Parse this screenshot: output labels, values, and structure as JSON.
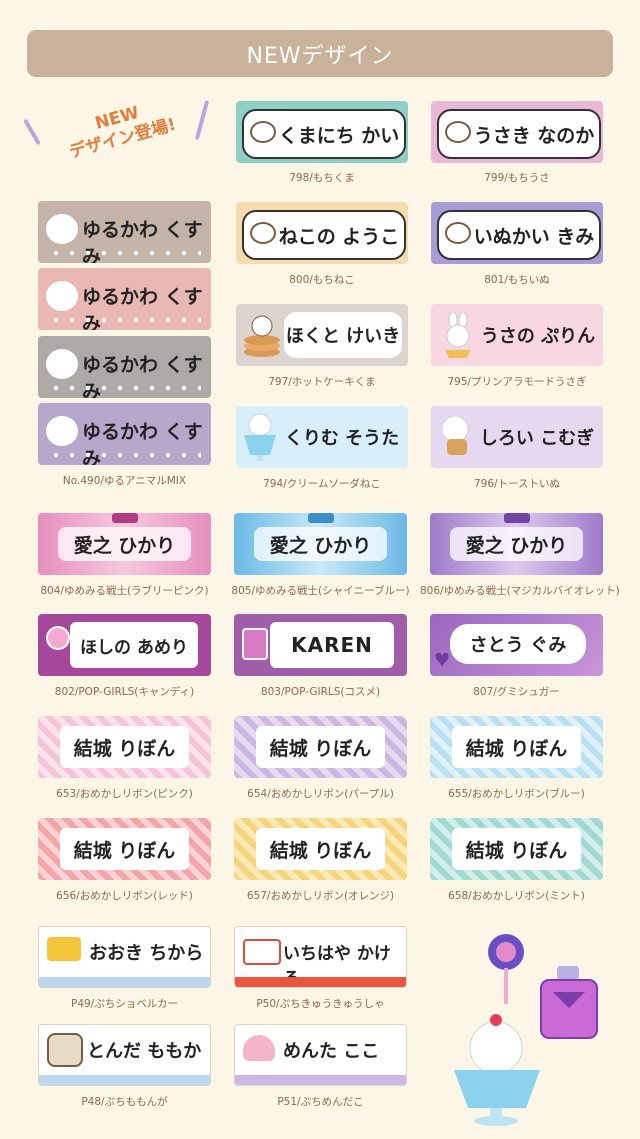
{
  "header": {
    "title": "NEWデザイン"
  },
  "promo": {
    "line1": "NEW",
    "line2": "デザイン登場!"
  },
  "rows": {
    "r1": [
      {
        "name": "くまにち かい",
        "caption": "798/もちくま"
      },
      {
        "name": "うさき なのか",
        "caption": "799/もちうさ"
      }
    ],
    "r2": [
      {
        "name": "ねこの ようこ",
        "caption": "800/もちねこ"
      },
      {
        "name": "いぬかい きみ",
        "caption": "801/もちいぬ"
      }
    ],
    "r3": [
      {
        "name": "ほくと けいき",
        "caption": "797/ホットケーキくま"
      },
      {
        "name": "うさの ぷりん",
        "caption": "795/プリンアラモードうさぎ"
      }
    ],
    "r4": [
      {
        "name": "くりむ そうた",
        "caption": "794/クリームソーダねこ"
      },
      {
        "name": "しろい こむぎ",
        "caption": "796/トーストいぬ"
      }
    ],
    "animal_mix": {
      "name": "ゆるかわ くすみ",
      "caption": "No.490/ゆるアニマルMIX"
    },
    "r5": [
      {
        "name": "愛之 ひかり",
        "caption": "804/ゆめみる戦士(ラブリーピンク)"
      },
      {
        "name": "愛之 ひかり",
        "caption": "805/ゆめみる戦士(シャイニーブルー)"
      },
      {
        "name": "愛之 ひかり",
        "caption": "806/ゆめみる戦士(マジカルバイオレット)"
      }
    ],
    "r6": [
      {
        "name": "ほしの あめり",
        "caption": "802/POP-GIRLS(キャンディ)"
      },
      {
        "name": "KAREN",
        "caption": "803/POP-GIRLS(コスメ)"
      },
      {
        "name": "さとう ぐみ",
        "caption": "807/グミシュガー"
      }
    ],
    "r7": [
      {
        "name": "結城 りぼん",
        "caption": "653/おめかしリボン(ピンク)"
      },
      {
        "name": "結城 りぼん",
        "caption": "654/おめかしリボン(パープル)"
      },
      {
        "name": "結城 りぼん",
        "caption": "655/おめかしリボン(ブルー)"
      }
    ],
    "r8": [
      {
        "name": "結城 りぼん",
        "caption": "656/おめかしリボン(レッド)"
      },
      {
        "name": "結城 りぼん",
        "caption": "657/おめかしリボン(オレンジ)"
      },
      {
        "name": "結城 りぼん",
        "caption": "658/おめかしリボン(ミント)"
      }
    ],
    "r9": [
      {
        "name": "おおき ちから",
        "caption": "P49/ぷちショベルカー"
      },
      {
        "name": "いちはや かける",
        "caption": "P50/ぷちきゅうきゅうしゃ"
      }
    ],
    "r10": [
      {
        "name": "とんだ ももか",
        "caption": "P48/ぷちももんが"
      },
      {
        "name": "めんた ここ",
        "caption": "P51/ぷちめんだこ"
      }
    ]
  },
  "colors": {
    "header": "#c8b29a",
    "background": "#fcf6e6",
    "caption": "#8a6b4b",
    "accent_orange": "#e07f3c"
  }
}
